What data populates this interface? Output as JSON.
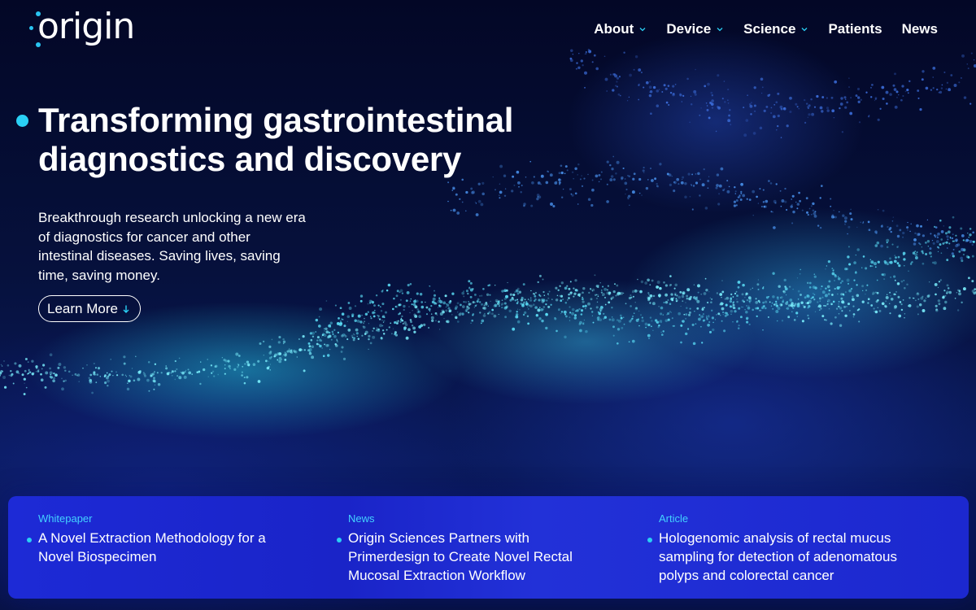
{
  "brand": {
    "logo_text": "origin",
    "accent_color": "#2ad0f5",
    "background_color": "#050a2e"
  },
  "nav": {
    "items": [
      {
        "label": "About",
        "has_dropdown": true
      },
      {
        "label": "Device",
        "has_dropdown": true
      },
      {
        "label": "Science",
        "has_dropdown": true
      },
      {
        "label": "Patients",
        "has_dropdown": false
      },
      {
        "label": "News",
        "has_dropdown": false
      }
    ]
  },
  "hero": {
    "title_line1": "Transforming gastrointestinal",
    "title_line2": "diagnostics and discovery",
    "subtitle": "Breakthrough research unlocking a new era of diagnostics for cancer and other intestinal diseases. Saving lives, saving time, saving money.",
    "cta_label": "Learn More",
    "cta_icon": "arrow-down-icon"
  },
  "cards": [
    {
      "tag": "Whitepaper",
      "title": "A Novel Extraction Methodology for a Novel Biospecimen"
    },
    {
      "tag": "News",
      "title": "Origin Sciences Partners with Primerdesign to Create Novel Rectal Mucosal Extraction Workflow"
    },
    {
      "tag": "Article",
      "title": "Hologenomic analysis of rectal mucus sampling for detection of adenomatous polyps and colorectal cancer"
    }
  ]
}
